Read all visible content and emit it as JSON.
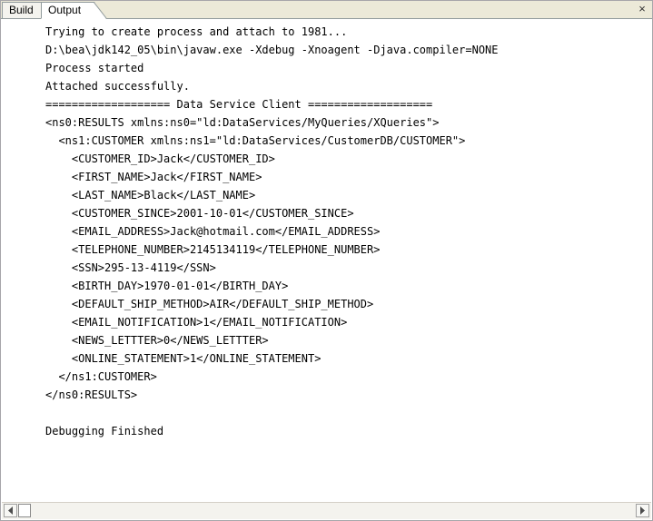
{
  "tabs": [
    {
      "label": "Build",
      "active": false
    },
    {
      "label": "Output",
      "active": true
    }
  ],
  "close_glyph": "×",
  "output_lines": [
    "Trying to create process and attach to 1981...",
    "D:\\bea\\jdk142_05\\bin\\javaw.exe -Xdebug -Xnoagent -Djava.compiler=NONE",
    "Process started",
    "Attached successfully.",
    "=================== Data Service Client ===================",
    "<ns0:RESULTS xmlns:ns0=\"ld:DataServices/MyQueries/XQueries\">",
    "  <ns1:CUSTOMER xmlns:ns1=\"ld:DataServices/CustomerDB/CUSTOMER\">",
    "    <CUSTOMER_ID>Jack</CUSTOMER_ID>",
    "    <FIRST_NAME>Jack</FIRST_NAME>",
    "    <LAST_NAME>Black</LAST_NAME>",
    "    <CUSTOMER_SINCE>2001-10-01</CUSTOMER_SINCE>",
    "    <EMAIL_ADDRESS>Jack@hotmail.com</EMAIL_ADDRESS>",
    "    <TELEPHONE_NUMBER>2145134119</TELEPHONE_NUMBER>",
    "    <SSN>295-13-4119</SSN>",
    "    <BIRTH_DAY>1970-01-01</BIRTH_DAY>",
    "    <DEFAULT_SHIP_METHOD>AIR</DEFAULT_SHIP_METHOD>",
    "    <EMAIL_NOTIFICATION>1</EMAIL_NOTIFICATION>",
    "    <NEWS_LETTTER>0</NEWS_LETTTER>",
    "    <ONLINE_STATEMENT>1</ONLINE_STATEMENT>",
    "  </ns1:CUSTOMER>",
    "</ns0:RESULTS>",
    "",
    "Debugging Finished"
  ],
  "scrollbar": {
    "left_icon": "scroll-left-arrow-icon",
    "right_icon": "scroll-right-arrow-icon"
  }
}
